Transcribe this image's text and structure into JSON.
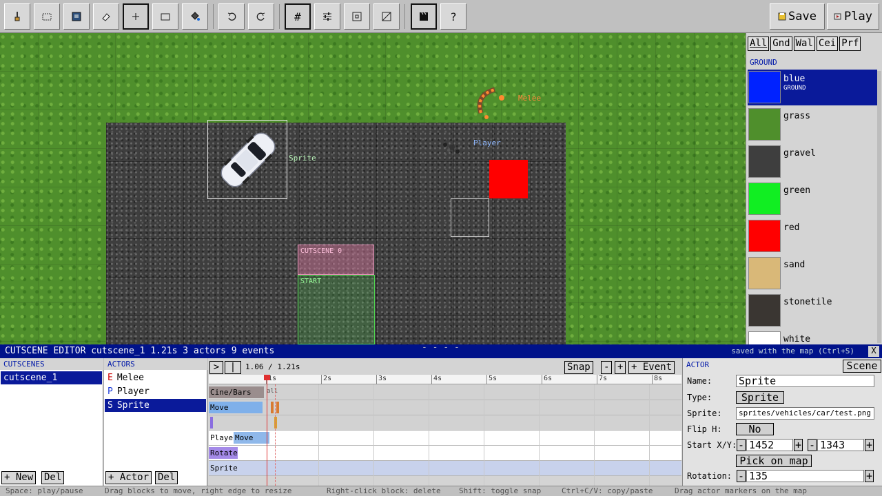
{
  "toolbar": {
    "tools": [
      {
        "name": "paint-tool",
        "icon": "paint-brush-icon"
      },
      {
        "name": "select-tool",
        "icon": "dashed-rect-icon"
      },
      {
        "name": "stamp-tool",
        "icon": "stamp-icon"
      },
      {
        "name": "eraser-tool",
        "icon": "eraser-icon"
      },
      {
        "name": "crosshair-tool",
        "icon": "crosshair-icon"
      },
      {
        "name": "rectangle-tool",
        "icon": "rectangle-icon"
      },
      {
        "name": "fill-tool",
        "icon": "paint-bucket-icon"
      },
      {
        "name": "undo",
        "icon": "undo-icon"
      },
      {
        "name": "redo",
        "icon": "redo-icon"
      },
      {
        "name": "grid-toggle",
        "icon": "grid-icon",
        "glyph": "#"
      },
      {
        "name": "properties",
        "icon": "sliders-icon"
      },
      {
        "name": "zone-tool",
        "icon": "zone-icon"
      },
      {
        "name": "collision-tool",
        "icon": "diagonal-box-icon"
      },
      {
        "name": "cutscene-toggle",
        "icon": "clapperboard-icon"
      },
      {
        "name": "help",
        "icon": "question-icon",
        "glyph": "?"
      }
    ],
    "save_label": "Save",
    "play_label": "Play"
  },
  "map": {
    "actors": [
      {
        "name": "Sprite",
        "color": "#b6f0b6"
      },
      {
        "name": "Player",
        "color": "#8fb8ff"
      },
      {
        "name": "Melee",
        "color": "#ff8a3c"
      }
    ],
    "zones": {
      "cutscene_label": "CUTSCENE 0",
      "start_label": "START"
    }
  },
  "palette": {
    "tabs": [
      "All",
      "Gnd",
      "Wal",
      "Cei",
      "Prf"
    ],
    "category": "GROUND",
    "items": [
      {
        "name": "blue",
        "sub": "GROUND",
        "color": "#0022ff"
      },
      {
        "name": "grass",
        "sub": "",
        "color": "#4f8f2c"
      },
      {
        "name": "gravel",
        "sub": "",
        "color": "#3e3e3e"
      },
      {
        "name": "green",
        "sub": "",
        "color": "#11ee22"
      },
      {
        "name": "red",
        "sub": "",
        "color": "#ff0000"
      },
      {
        "name": "sand",
        "sub": "",
        "color": "#d9b878"
      },
      {
        "name": "stonetile",
        "sub": "",
        "color": "#3a3632"
      },
      {
        "name": "white",
        "sub": "",
        "color": "#ffffff"
      }
    ]
  },
  "editor": {
    "title": "CUTSCENE EDITOR  cutscene_1    1.21s    3 actors    9 events",
    "hint": "saved with the map (Ctrl+S)",
    "close": "X",
    "cutscenes_header": "CUTSCENES",
    "cutscenes": [
      "cutscene_1"
    ],
    "new_label": "+ New",
    "del_label": "Del",
    "actors_header": "ACTORS",
    "actors": [
      {
        "letter": "E",
        "name": "Melee"
      },
      {
        "letter": "P",
        "name": "Player"
      },
      {
        "letter": "S",
        "name": "Sprite"
      }
    ],
    "add_actor_label": "+ Actor",
    "del_actor_label": "Del"
  },
  "timeline": {
    "play_glyph": ">",
    "rewind_glyph": "|<",
    "time_display": "1.06 / 1.21s",
    "snap_label": "Snap",
    "zoom_out": "-",
    "zoom_in": "+",
    "add_event_label": "+ Event",
    "ticks": [
      "1s",
      "2s",
      "3s",
      "4s",
      "5s",
      "6s",
      "7s",
      "8s"
    ],
    "tracks": [
      {
        "label": "Cine/Bars",
        "block_label": "Cine/Bars",
        "block_color": "#9a8d8d",
        "extra": "all"
      },
      {
        "label": "Move",
        "block_label": "Move",
        "block_color": "#7fb0ea"
      },
      {
        "label": "",
        "block_label": "",
        "block_color": "#8a6ee0"
      },
      {
        "label": "Player",
        "block_label": "Move",
        "block_color": "#8fb8ea"
      },
      {
        "label": "Rotate",
        "block_label": "Rotate",
        "block_color": "#a48ae8"
      },
      {
        "label": "Sprite",
        "block_label": "",
        "block_color": "#c8d2ec"
      }
    ]
  },
  "props": {
    "header": "ACTOR",
    "scene_label": "Scene",
    "name_label": "Name:",
    "name_value": "Sprite",
    "type_label": "Type:",
    "type_value": "Sprite",
    "sprite_label": "Sprite:",
    "sprite_value": "sprites/vehicles/car/test.png",
    "flip_label": "Flip H:",
    "flip_value": "No",
    "start_label": "Start X/Y:",
    "start_x": "1452",
    "start_y": "1343",
    "minus": "-",
    "plus": "+",
    "pick_label": "Pick on map",
    "rotation_label": "Rotation:",
    "rotation_value": "135"
  },
  "status": {
    "space": "Space: play/pause",
    "drag": "Drag blocks to move, right edge to resize",
    "rclick": "Right-click block: delete",
    "shift": "Shift: toggle snap",
    "copy": "Ctrl+C/V: copy/paste",
    "markers": "Drag actor markers on the map"
  }
}
